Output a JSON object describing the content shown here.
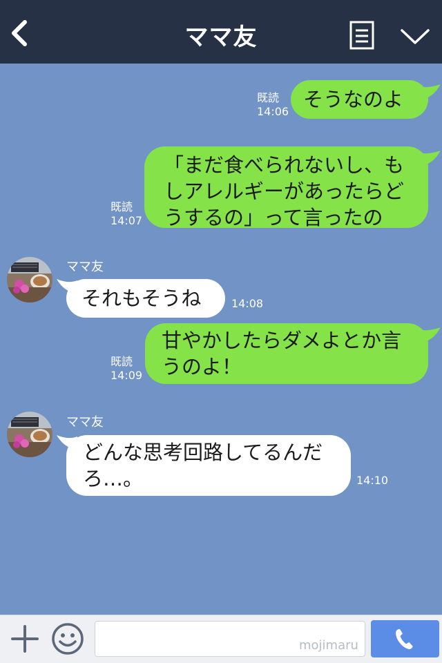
{
  "header": {
    "title": "ママ友"
  },
  "messages": [
    {
      "side": "out",
      "text": "そうなのよ",
      "read": "既読",
      "time": "14:06"
    },
    {
      "side": "out",
      "text": "「まだ食べられないし、もしアレルギーがあったらどうするの」って言ったの",
      "read": "既読",
      "time": "14:07"
    },
    {
      "side": "in",
      "sender": "ママ友",
      "text": "それもそうね",
      "time": "14:08"
    },
    {
      "side": "out",
      "text": "甘やかしたらダメよとか言うのよ！",
      "read": "既読",
      "time": "14:09"
    },
    {
      "side": "in",
      "sender": "ママ友",
      "text": "どんな思考回路してるんだろ…。",
      "time": "14:10"
    }
  ],
  "footer": {
    "input_value": "",
    "watermark": "mojimaru"
  },
  "colors": {
    "background": "#7193c5",
    "header": "#263145",
    "outgoing_bubble": "#85e249",
    "incoming_bubble": "#ffffff",
    "call_button": "#5b8de6"
  }
}
